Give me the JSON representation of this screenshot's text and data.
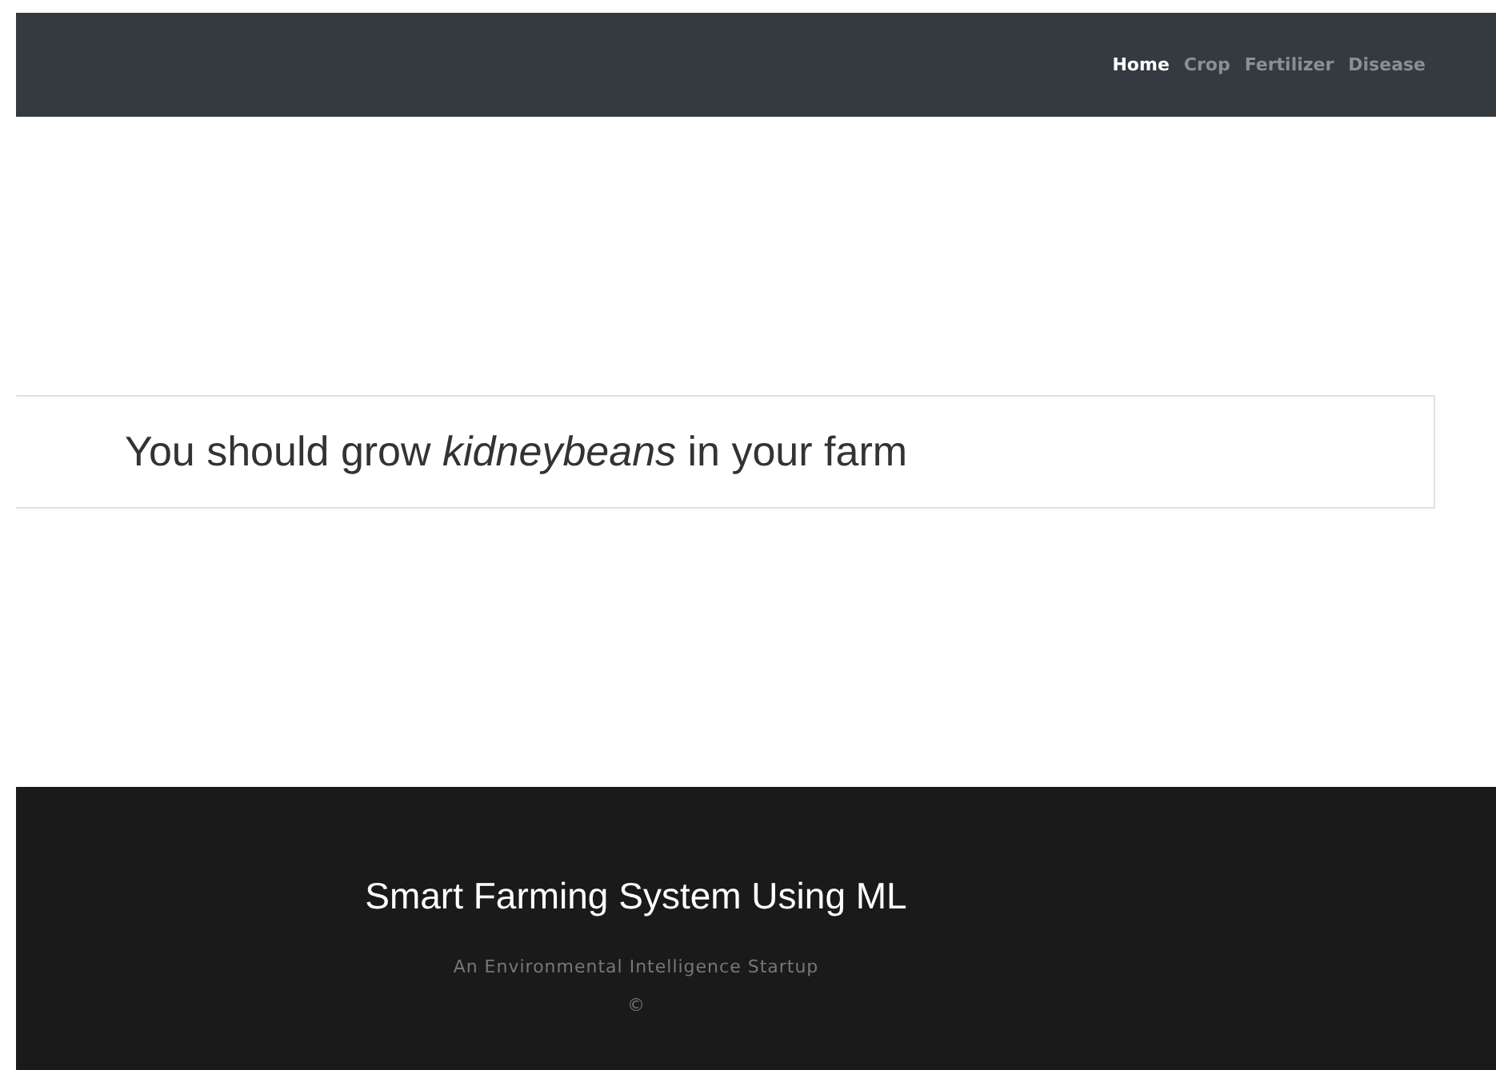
{
  "navbar": {
    "links": [
      {
        "label": "Home",
        "selected": true
      },
      {
        "label": "Crop",
        "selected": false
      },
      {
        "label": "Fertilizer",
        "selected": false
      },
      {
        "label": "Disease",
        "selected": false
      }
    ]
  },
  "result": {
    "text": "You should grow *kidneybeans* in your farm"
  },
  "footer": {
    "title": "Smart Farming System Using ML",
    "tagline": "An Environmental Intelligence Startup",
    "copyright": "©"
  }
}
